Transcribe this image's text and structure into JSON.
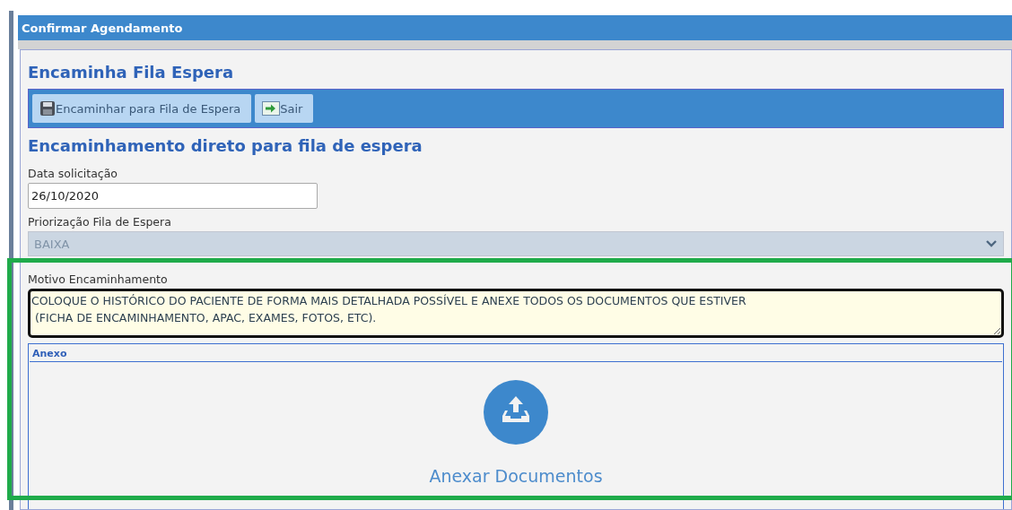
{
  "window": {
    "title": "Confirmar Agendamento"
  },
  "heading": "Encaminha Fila Espera",
  "toolbar": [
    {
      "label": "Encaminhar para Fila de Espera",
      "kind": "save"
    },
    {
      "label": "Sair",
      "kind": "exit"
    }
  ],
  "section_title": "Encaminhamento direto para fila de espera",
  "fields": [
    {
      "kind": "text",
      "label": "Data solicitação",
      "value": "26/10/2020"
    },
    {
      "kind": "select",
      "label": "Priorização Fila de Espera",
      "value": "BAIXA",
      "disabled": true
    },
    {
      "kind": "textarea",
      "label": "Motivo Encaminhamento",
      "value": "COLOQUE O HISTÓRICO DO PACIENTE DE FORMA MAIS DETALHADA POSSÍVEL E ANEXE TODOS OS DOCUMENTOS QUE ESTIVER\n (FICHA DE ENCAMINHAMENTO, APAC, EXAMES, FOTOS, ETC)."
    }
  ],
  "attachment": {
    "legend": "Anexo",
    "action": "Anexar Documentos"
  }
}
